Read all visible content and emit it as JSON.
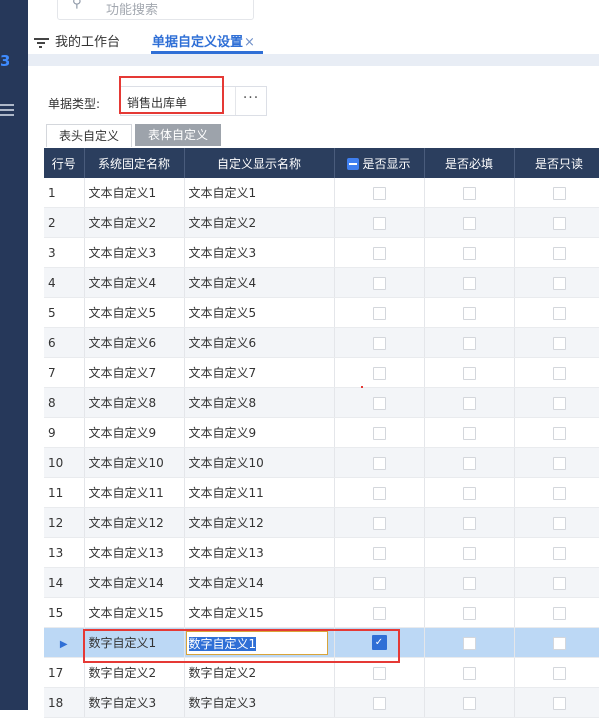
{
  "search": {
    "placeholder": "功能搜索",
    "icon": "search-icon"
  },
  "sidebar": {
    "number": "3",
    "icon": "menu-icon"
  },
  "tabs": [
    {
      "label": "我的工作台",
      "icon": "workbench-icon"
    },
    {
      "label": "单据自定义设置",
      "close": "×"
    }
  ],
  "form": {
    "type_label": "单据类型:",
    "type_value": "销售出库单",
    "more_button": "···"
  },
  "subtabs": [
    "表头自定义",
    "表体自定义"
  ],
  "grid": {
    "columns": [
      "行号",
      "系统固定名称",
      "自定义显示名称",
      "是否显示",
      "是否必填",
      "是否只读"
    ],
    "rows": [
      {
        "no": "1",
        "system": "文本自定义1",
        "display": "文本自定义1",
        "show": false
      },
      {
        "no": "2",
        "system": "文本自定义2",
        "display": "文本自定义2",
        "show": false
      },
      {
        "no": "3",
        "system": "文本自定义3",
        "display": "文本自定义3",
        "show": false
      },
      {
        "no": "4",
        "system": "文本自定义4",
        "display": "文本自定义4",
        "show": false
      },
      {
        "no": "5",
        "system": "文本自定义5",
        "display": "文本自定义5",
        "show": false
      },
      {
        "no": "6",
        "system": "文本自定义6",
        "display": "文本自定义6",
        "show": false
      },
      {
        "no": "7",
        "system": "文本自定义7",
        "display": "文本自定义7",
        "show": false
      },
      {
        "no": "8",
        "system": "文本自定义8",
        "display": "文本自定义8",
        "show": false
      },
      {
        "no": "9",
        "system": "文本自定义9",
        "display": "文本自定义9",
        "show": false
      },
      {
        "no": "10",
        "system": "文本自定义10",
        "display": "文本自定义10",
        "show": false
      },
      {
        "no": "11",
        "system": "文本自定义11",
        "display": "文本自定义11",
        "show": false
      },
      {
        "no": "12",
        "system": "文本自定义12",
        "display": "文本自定义12",
        "show": false
      },
      {
        "no": "13",
        "system": "文本自定义13",
        "display": "文本自定义13",
        "show": false
      },
      {
        "no": "14",
        "system": "文本自定义14",
        "display": "文本自定义14",
        "show": false
      },
      {
        "no": "15",
        "system": "文本自定义15",
        "display": "文本自定义15",
        "show": false
      },
      {
        "no": "▶",
        "system": "数字自定义1",
        "display": "数字自定义1",
        "show": true,
        "selected": true
      },
      {
        "no": "17",
        "system": "数字自定义2",
        "display": "数字自定义2",
        "show": false
      },
      {
        "no": "18",
        "system": "数字自定义3",
        "display": "数字自定义3",
        "show": false
      }
    ]
  },
  "colors": {
    "accent": "#2f6fd6",
    "header_bg": "#2b3e5e",
    "sidebar_bg": "#26385a",
    "highlight": "#e53935",
    "selected_row": "#bcd8f5"
  }
}
